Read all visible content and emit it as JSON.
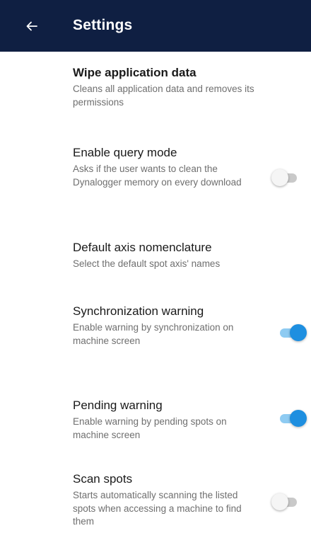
{
  "appbar": {
    "title": "Settings",
    "back_icon": "arrow-left-icon"
  },
  "colors": {
    "appbar_bg": "#0f1f42",
    "switch_on_thumb": "#1e8fe0",
    "switch_on_track": "#8ecbf2",
    "switch_off_track": "#c9c9c9"
  },
  "settings": [
    {
      "title": "Wipe application data",
      "description": "Cleans all application data and removes its permissions",
      "has_switch": false
    },
    {
      "title": "Enable query mode",
      "description": "Asks if the user wants to clean the Dynalogger memory on every download",
      "has_switch": true,
      "enabled": false
    },
    {
      "title": "Default axis nomenclature",
      "description": "Select the default spot axis' names",
      "has_switch": false
    },
    {
      "title": "Synchronization warning",
      "description": "Enable warning by synchronization on machine screen",
      "has_switch": true,
      "enabled": true
    },
    {
      "title": "Pending warning",
      "description": "Enable warning by pending spots on machine screen",
      "has_switch": true,
      "enabled": true
    },
    {
      "title": "Scan spots",
      "description": "Starts automatically scanning the listed spots when accessing a machine to find them",
      "has_switch": true,
      "enabled": false
    }
  ]
}
